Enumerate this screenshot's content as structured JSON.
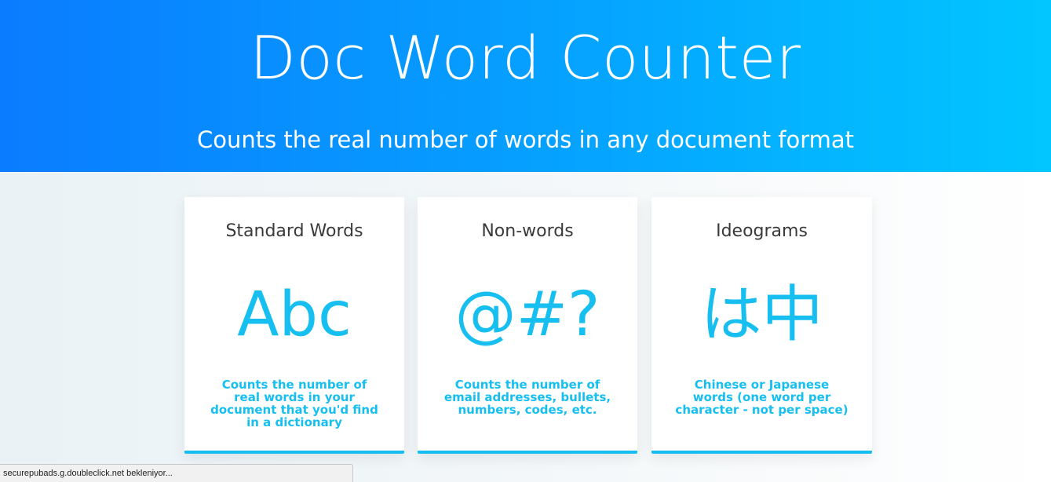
{
  "hero": {
    "title": "Doc Word Counter",
    "subtitle": "Counts the real number of words in any document format"
  },
  "cards": [
    {
      "title": "Standard Words",
      "glyph": "Abc",
      "description": "Counts the number of real words in your document that you'd find in a dictionary"
    },
    {
      "title": "Non-words",
      "glyph": "@#?",
      "description": "Counts the number of email addresses, bullets, numbers, codes, etc."
    },
    {
      "title": "Ideograms",
      "glyph": "は中",
      "description": "Chinese or Japanese words (one word per character - not per space)"
    }
  ],
  "status_bar": {
    "text": "securepubads.g.doubleclick.net bekleniyor..."
  },
  "colors": {
    "hero_gradient_start": "#0a7cff",
    "hero_gradient_end": "#01c6ff",
    "accent": "#16bff0",
    "card_title": "#3a3a3a"
  }
}
